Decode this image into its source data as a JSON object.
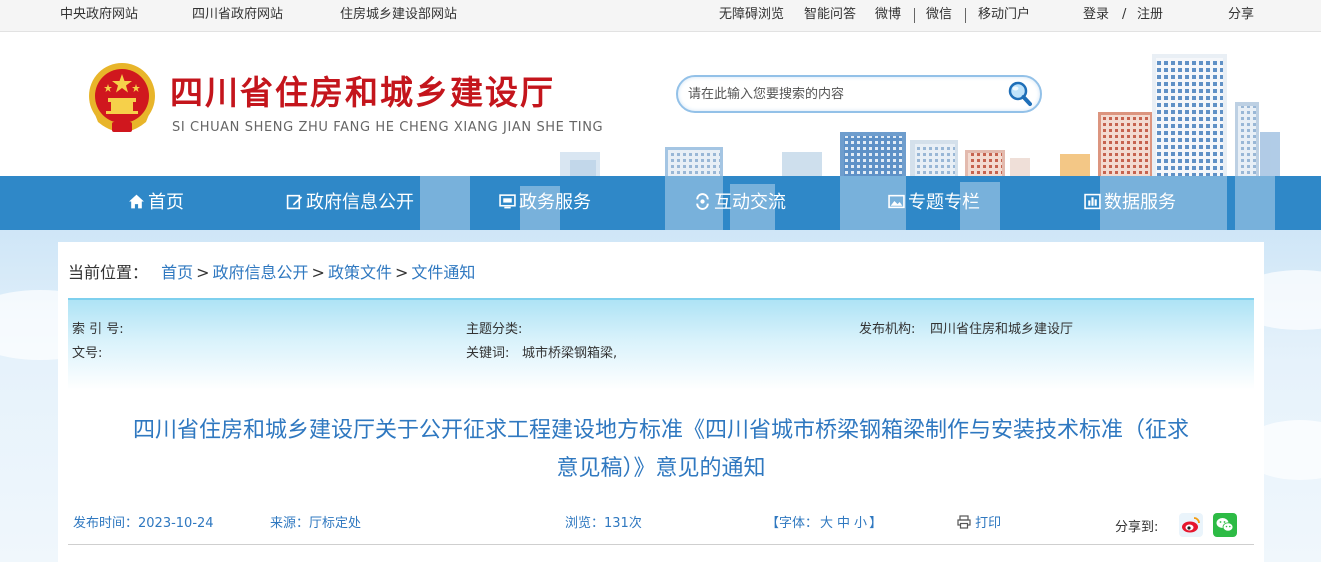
{
  "topbar": {
    "links_left": [
      "中央政府网站",
      "四川省政府网站",
      "住房城乡建设部网站"
    ],
    "links_right": [
      "无障碍浏览",
      "智能问答",
      "微博",
      "微信",
      "移动门户"
    ],
    "login": "登录",
    "slash": "/",
    "register": "注册",
    "share": "分享"
  },
  "header": {
    "title": "四川省住房和城乡建设厅",
    "subtitle": "SI CHUAN SHENG ZHU FANG HE CHENG XIANG JIAN SHE TING",
    "search_placeholder": "请在此输入您要搜索的内容",
    "emblem_icon": "national-emblem-icon",
    "search_icon": "magnifier-icon"
  },
  "nav": {
    "items": [
      {
        "label": "首页",
        "icon": "home-icon"
      },
      {
        "label": "政府信息公开",
        "icon": "edit-icon"
      },
      {
        "label": "政务服务",
        "icon": "monitor-icon"
      },
      {
        "label": "互动交流",
        "icon": "interaction-icon"
      },
      {
        "label": "专题专栏",
        "icon": "image-icon"
      },
      {
        "label": "数据服务",
        "icon": "bar-chart-icon"
      }
    ]
  },
  "breadcrumb": {
    "prefix": "当前位置：",
    "items": [
      "首页",
      "政府信息公开",
      "政策文件",
      "文件通知"
    ],
    "separator": ">"
  },
  "meta": {
    "index_label": "索 引 号:",
    "index_value": "",
    "topic_label": "主题分类:",
    "topic_value": "",
    "publisher_label": "发布机构:",
    "publisher_value": "四川省住房和城乡建设厅",
    "doc_no_label": "文号:",
    "doc_no_value": "",
    "keywords_label": "关键词:",
    "keywords_value": "城市桥梁钢箱梁,"
  },
  "article": {
    "title_line1": "四川省住房和城乡建设厅关于公开征求工程建设地方标准《四川省城市桥梁钢箱梁制作与安装技术标准（征求",
    "title_line2": "意见稿）》意见的通知",
    "date_label": "发布时间：",
    "date_value": "2023-10-24",
    "source_label": "来源：",
    "source_value": "厅标定处",
    "views_label": "浏览：",
    "views_value": "131次",
    "font_label": "【字体：",
    "font_large": "大",
    "font_medium": "中",
    "font_small": "小",
    "font_end": "】",
    "print_label": "打印",
    "share_label": "分享到:"
  },
  "colors": {
    "brand_red": "#c4151c",
    "nav_blue": "#2f88c8",
    "link_blue": "#2f78c0"
  }
}
